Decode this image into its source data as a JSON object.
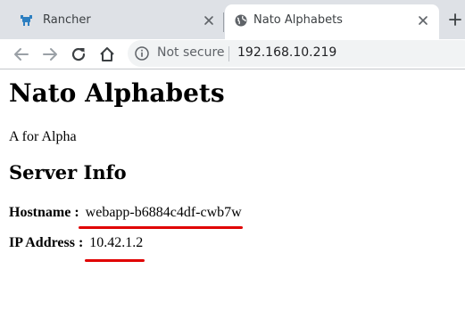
{
  "browser": {
    "tabs": [
      {
        "title": "Rancher",
        "active": false,
        "favicon": "rancher-logo-icon"
      },
      {
        "title": "Nato Alphabets",
        "active": true,
        "favicon": "globe-icon"
      }
    ],
    "security_label": "Not secure",
    "url": "192.168.10.219"
  },
  "page": {
    "title": "Nato Alphabets",
    "greeting": "A for Alpha",
    "server_info": {
      "heading": "Server Info",
      "hostname_label": "Hostname :",
      "hostname_value": "webapp-b6884c4df-cwb7w",
      "ip_label": "IP Address :",
      "ip_value": "10.42.1.2"
    }
  },
  "colors": {
    "tabstrip_bg": "#dee1e6",
    "omnibox_bg": "#f1f3f4",
    "highlight_underline": "#e00000",
    "rancher_blue": "#2d7fc1"
  }
}
